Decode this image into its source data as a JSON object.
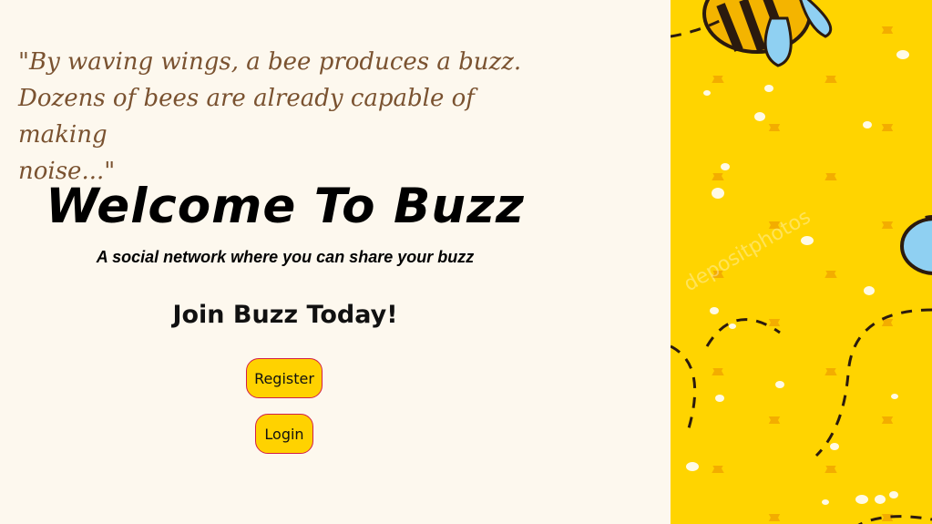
{
  "quote": {
    "line1": "\"By waving wings, a bee produces a buzz.",
    "line2": "Dozens of bees are already capable of making",
    "line3": "noise...\""
  },
  "hero": {
    "title": "Welcome To Buzz",
    "tagline": "A social network where you can share your buzz"
  },
  "cta": {
    "heading": "Join Buzz Today!",
    "register_label": "Register",
    "login_label": "Login"
  },
  "image": {
    "watermark": "depositphotos"
  },
  "colors": {
    "background": "#fdf8ee",
    "quote_text": "#7a5230",
    "button_fill": "#ffd200",
    "button_border": "#d21f4a",
    "honeycomb": "#ffd400",
    "honeycomb_edge": "#f2a900"
  }
}
